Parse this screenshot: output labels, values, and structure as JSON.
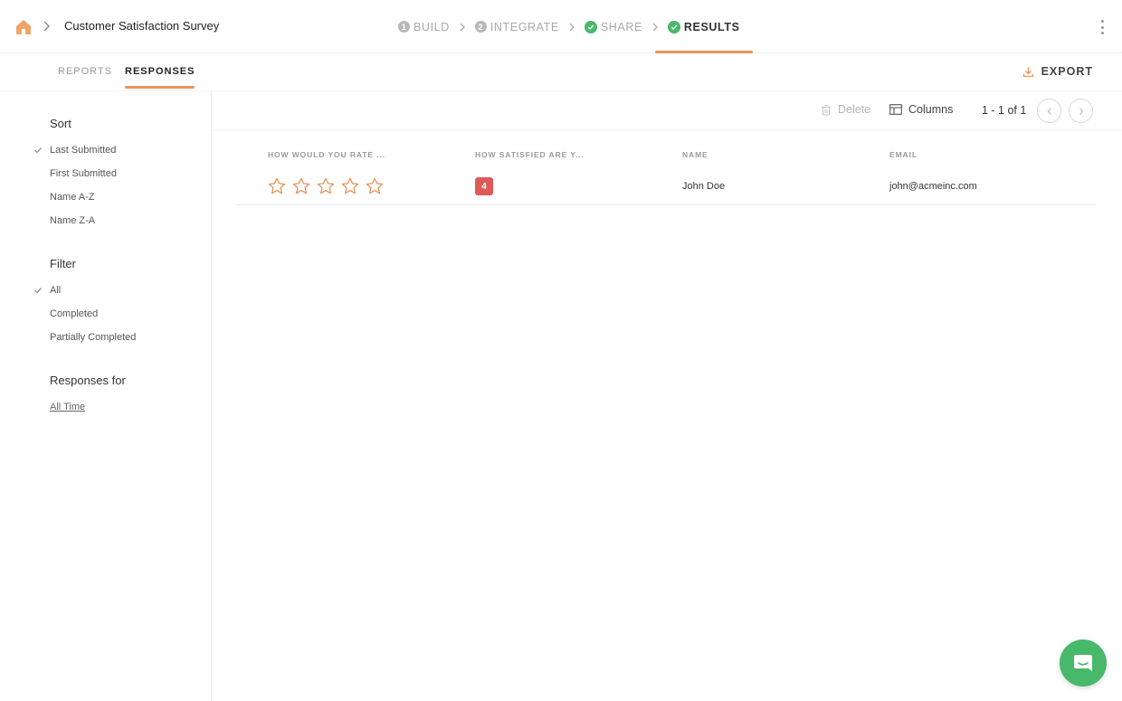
{
  "header": {
    "survey_title": "Customer Satisfaction Survey",
    "steps": [
      {
        "num": "1",
        "label": "BUILD"
      },
      {
        "num": "2",
        "label": "INTEGRATE"
      },
      {
        "label": "SHARE"
      },
      {
        "label": "RESULTS"
      }
    ]
  },
  "subnav": {
    "tabs": [
      "REPORTS",
      "RESPONSES"
    ],
    "export_label": "EXPORT"
  },
  "sidebar": {
    "sort_heading": "Sort",
    "sort_options": [
      "Last Submitted",
      "First Submitted",
      "Name A-Z",
      "Name Z-A"
    ],
    "filter_heading": "Filter",
    "filter_options": [
      "All",
      "Completed",
      "Partially Completed"
    ],
    "responses_heading": "Responses for",
    "responses_range": "All Time"
  },
  "toolbar": {
    "delete_label": "Delete",
    "columns_label": "Columns",
    "pagination": "1 - 1 of 1"
  },
  "table": {
    "columns": [
      "HOW WOULD YOU RATE ...",
      "HOW SATISFIED ARE Y...",
      "NAME",
      "EMAIL"
    ],
    "rows": [
      {
        "stars_filled": 0,
        "stars_total": 5,
        "satisfaction": "4",
        "name": "John Doe",
        "email": "john@acmeinc.com"
      }
    ]
  },
  "colors": {
    "accent": "#e8935b",
    "success": "#48b86b",
    "badge": "#e05a5a"
  }
}
